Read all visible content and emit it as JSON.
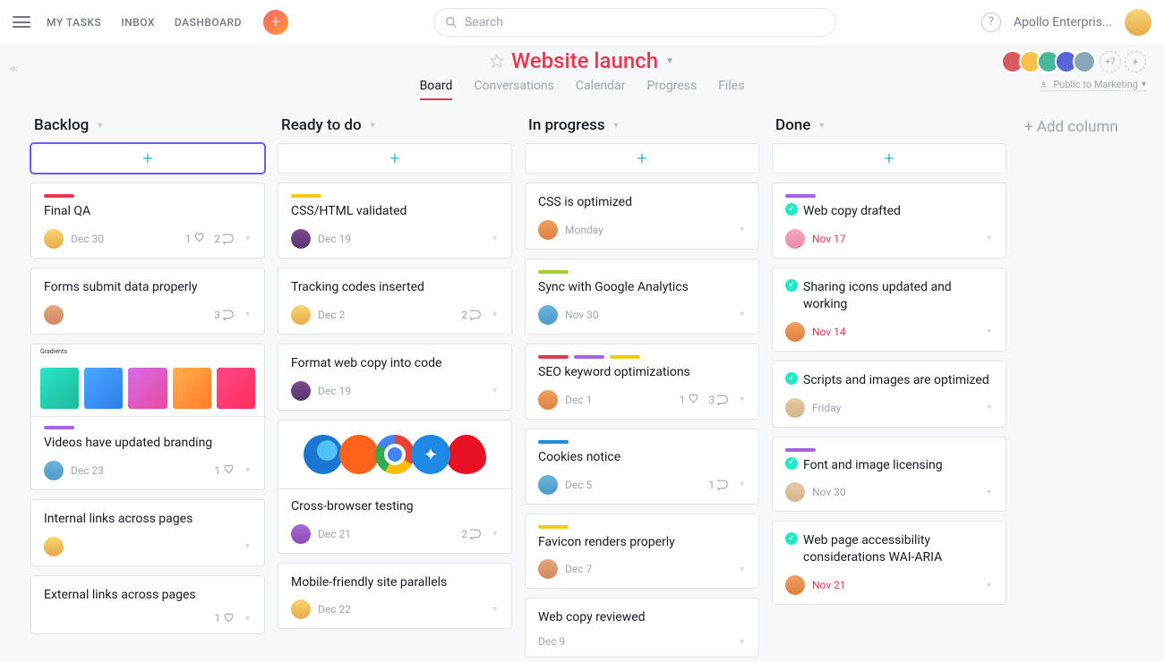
{
  "nav": {
    "my_tasks": "MY TASKS",
    "inbox": "INBOX",
    "dashboard": "DASHBOARD"
  },
  "search_placeholder": "Search",
  "workspace": "Apollo Enterpris...",
  "project": {
    "title": "Website launch",
    "tabs": [
      "Board",
      "Conversations",
      "Calendar",
      "Progress",
      "Files"
    ],
    "active_tab": "Board",
    "members_extra": "+7",
    "visibility": "Public to Marketing"
  },
  "add_column": "+ Add column",
  "columns": [
    {
      "name": "Backlog",
      "add_selected": true,
      "cards": [
        {
          "tags": [
            "#e8384f"
          ],
          "title": "Final QA",
          "avatar": "av1",
          "date": "Dec 30",
          "likes": 1,
          "comments": 2
        },
        {
          "title": "Forms submit data properly",
          "avatar": "av3",
          "comments": 3
        },
        {
          "image": "gradients",
          "tags": [
            "#aa62e3"
          ],
          "title": "Videos have updated branding",
          "avatar": "av4",
          "date": "Dec 23",
          "likes": 1
        },
        {
          "title": "Internal links across pages",
          "avatar": "av1"
        },
        {
          "title": "External links across pages",
          "likes": 1
        }
      ]
    },
    {
      "name": "Ready to do",
      "cards": [
        {
          "tags": [
            "#eecc16"
          ],
          "title": "CSS/HTML validated",
          "avatar": "av2",
          "date": "Dec 19"
        },
        {
          "title": "Tracking codes inserted",
          "avatar": "av1",
          "date": "Dec 2",
          "comments": 2
        },
        {
          "title": "Format web copy into code",
          "avatar": "av2",
          "date": "Dec 19"
        },
        {
          "image": "browsers",
          "title": "Cross-browser testing",
          "avatar": "av6",
          "date": "Dec 21",
          "comments": 2
        },
        {
          "title": "Mobile-friendly site parallels",
          "avatar": "av1",
          "date": "Dec 22"
        }
      ]
    },
    {
      "name": "In progress",
      "cards": [
        {
          "title": "CSS is optimized",
          "avatar": "av8",
          "date": "Monday"
        },
        {
          "tags": [
            "#a4cf30"
          ],
          "title": "Sync with Google Analytics",
          "avatar": "av4",
          "date": "Nov 30"
        },
        {
          "tags": [
            "#e8384f",
            "#aa62e3",
            "#eecc16"
          ],
          "title": "SEO keyword optimizations",
          "avatar": "av8",
          "date": "Dec 1",
          "likes": 1,
          "comments": 3
        },
        {
          "tags": [
            "#208ddf"
          ],
          "title": "Cookies notice",
          "avatar": "av4",
          "date": "Dec 5",
          "comments": 1
        },
        {
          "tags": [
            "#eecc16"
          ],
          "title": "Favicon renders properly",
          "avatar": "av3",
          "date": "Dec 7"
        },
        {
          "title": "Web copy reviewed",
          "date": "Dec 9"
        }
      ]
    },
    {
      "name": "Done",
      "cards": [
        {
          "tags": [
            "#aa62e3"
          ],
          "title": "Web copy drafted",
          "done": true,
          "avatar": "av7",
          "date": "Nov 17",
          "date_red": true
        },
        {
          "title": "Sharing icons updated and working",
          "done": true,
          "avatar": "av8",
          "date": "Nov 14",
          "date_red": true
        },
        {
          "title": "Scripts and images are optimized",
          "done": true,
          "avatar": "av5",
          "date": "Friday"
        },
        {
          "tags": [
            "#aa62e3"
          ],
          "title": "Font and image licensing",
          "done": true,
          "avatar": "av5",
          "date": "Nov 30"
        },
        {
          "title": "Web page accessibility considerations WAI-ARIA",
          "done": true,
          "avatar": "av8",
          "date": "Nov 21",
          "date_red": true
        }
      ]
    }
  ]
}
